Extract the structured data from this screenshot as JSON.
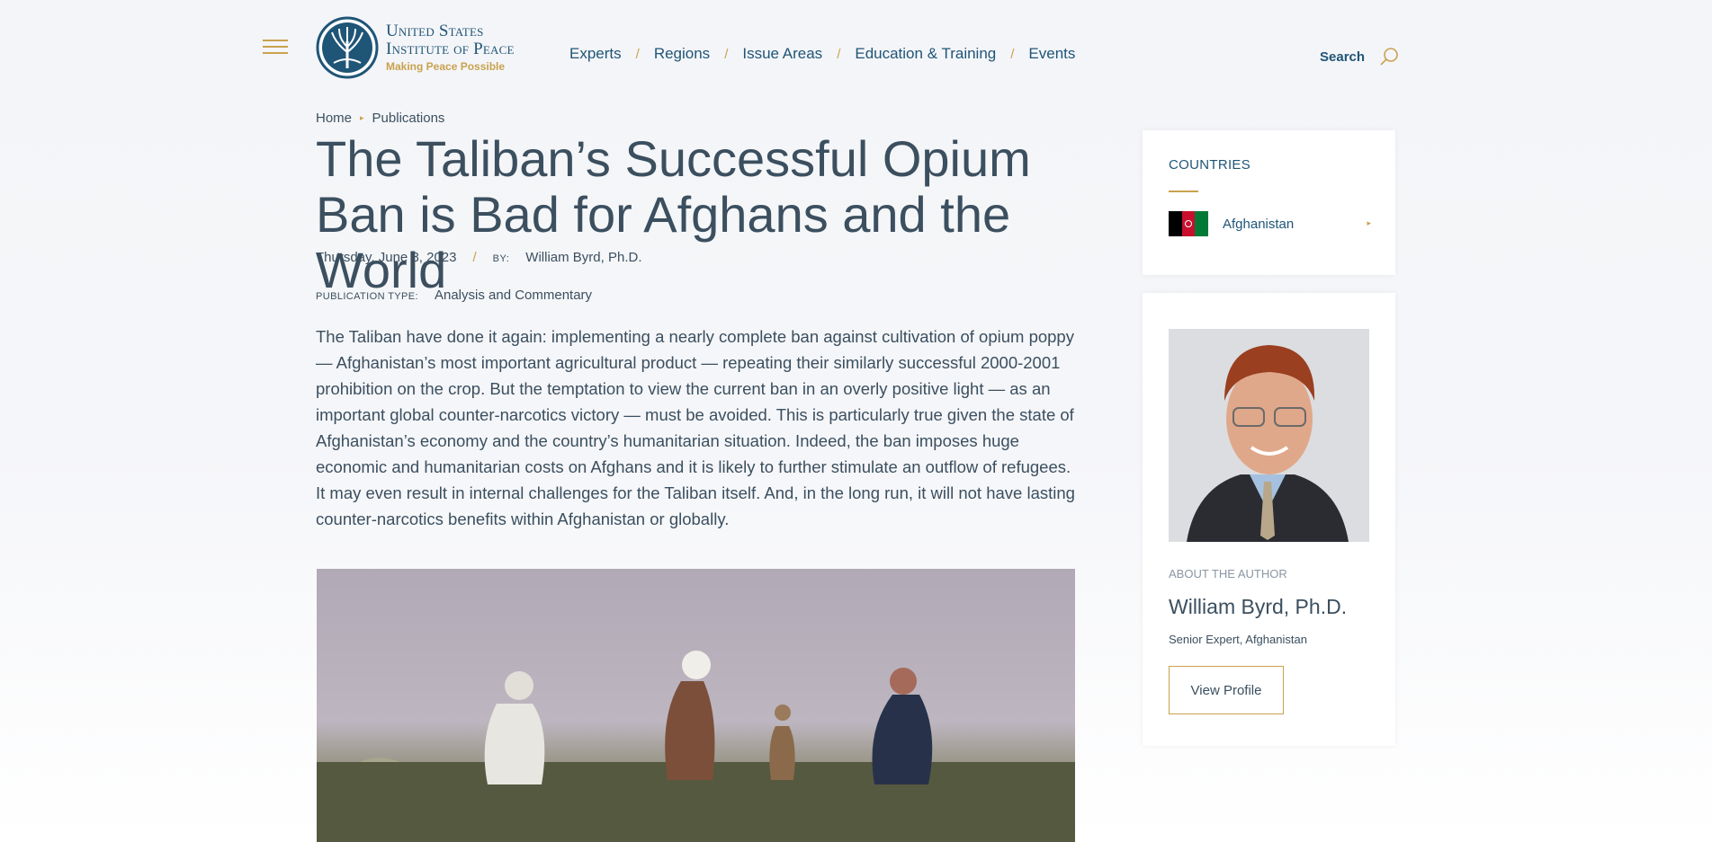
{
  "header": {
    "logo": {
      "line1": "United States",
      "line2": "Institute of Peace",
      "tagline": "Making Peace Possible"
    },
    "nav": [
      "Experts",
      "Regions",
      "Issue Areas",
      "Education & Training",
      "Events"
    ],
    "nav_separator": "/",
    "search_label": "Search"
  },
  "breadcrumb": [
    "Home",
    "Publications"
  ],
  "article": {
    "title": "The Taliban’s Successful Opium Ban is Bad for Afghans and the World",
    "date": "Thursday, June 8, 2023",
    "by_label": "BY:",
    "author": "William Byrd, Ph.D.",
    "publication_type_label": "PUBLICATION TYPE:",
    "publication_type": "Analysis and Commentary",
    "summary": "The Taliban have done it again: implementing a nearly complete ban against cultivation of opium poppy — Afghanistan’s most important agricultural product — repeating their similarly successful 2000-2001 prohibition on the crop. But the temptation to view the current ban in an overly positive light — as an important global counter-narcotics victory — must be avoided. This is particularly true given the state of Afghanistan’s economy and the country’s humanitarian situation. Indeed, the ban imposes huge economic and humanitarian costs on Afghans and it is likely to further stimulate an outflow of refugees. It may even result in internal challenges for the Taliban itself. And, in the long run, it will not have lasting counter-narcotics benefits within Afghanistan or globally."
  },
  "sidebar": {
    "countries": {
      "heading": "COUNTRIES",
      "items": [
        {
          "name": "Afghanistan",
          "flag_colors": [
            "#000000",
            "#c8102e",
            "#007a36"
          ]
        }
      ]
    },
    "author": {
      "about_label": "ABOUT THE AUTHOR",
      "name": "William Byrd, Ph.D.",
      "role": "Senior Expert, Afghanistan",
      "button": "View Profile"
    }
  },
  "colors": {
    "accent_gold": "#c9a24e",
    "brand_blue": "#1f5577",
    "text": "#3b4f5f"
  }
}
